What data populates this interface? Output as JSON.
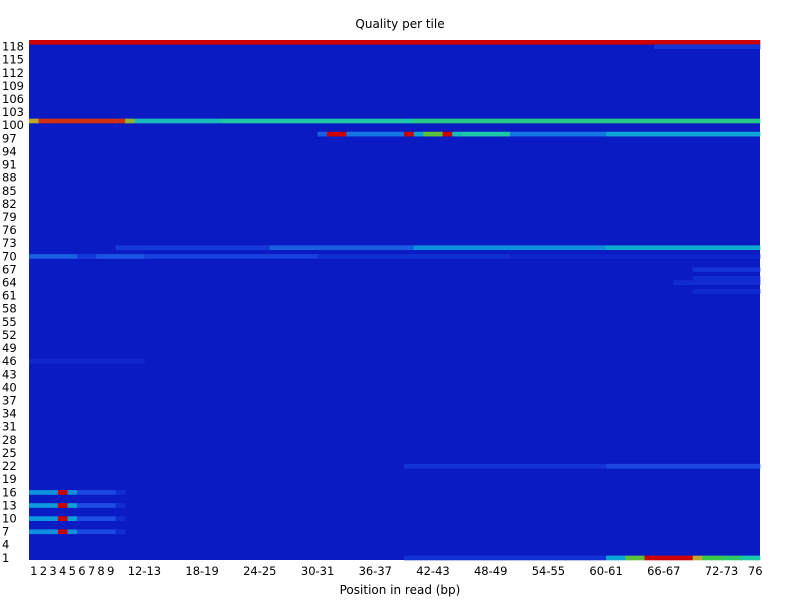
{
  "chart_data": {
    "type": "heatmap",
    "title": "Quality per tile",
    "xlabel": "Position in read (bp)",
    "ylabel": "",
    "x_tick_labels": [
      "1",
      "2",
      "3",
      "4",
      "5",
      "6",
      "7",
      "8",
      "9",
      "12-13",
      "18-19",
      "24-25",
      "30-31",
      "36-37",
      "42-43",
      "48-49",
      "54-55",
      "60-61",
      "66-67",
      "72-73",
      "76"
    ],
    "y_tick_labels": [
      "1",
      "4",
      "7",
      "10",
      "13",
      "16",
      "19",
      "22",
      "25",
      "28",
      "31",
      "34",
      "37",
      "40",
      "43",
      "46",
      "49",
      "52",
      "55",
      "58",
      "61",
      "64",
      "67",
      "70",
      "73",
      "76",
      "79",
      "82",
      "85",
      "88",
      "91",
      "94",
      "97",
      "100",
      "103",
      "106",
      "109",
      "112",
      "115",
      "118"
    ],
    "x_range": [
      1,
      76
    ],
    "y_range": [
      1,
      118
    ],
    "color_scale": [
      "#0a1bc4",
      "#1e4ee6",
      "#0aa0dc",
      "#1cc8a8",
      "#3cc83c",
      "#e0a030",
      "#cc0000"
    ],
    "background_value": 0,
    "rows": [
      {
        "tile": 119,
        "segments": [
          {
            "from": 1,
            "to": 76,
            "value": 1.0
          }
        ]
      },
      {
        "tile": 118,
        "segments": [
          {
            "from": 66,
            "to": 76,
            "value": 0.08
          }
        ]
      },
      {
        "tile": 101,
        "segments": [
          {
            "from": 1,
            "to": 1,
            "value": 0.8
          },
          {
            "from": 2,
            "to": 10,
            "value": 0.95
          },
          {
            "from": 11,
            "to": 11,
            "value": 0.75
          },
          {
            "from": 12,
            "to": 20,
            "value": 0.45
          },
          {
            "from": 21,
            "to": 40,
            "value": 0.5
          },
          {
            "from": 41,
            "to": 60,
            "value": 0.55
          },
          {
            "from": 61,
            "to": 76,
            "value": 0.55
          }
        ]
      },
      {
        "tile": 98,
        "segments": [
          {
            "from": 31,
            "to": 31,
            "value": 0.2
          },
          {
            "from": 32,
            "to": 33,
            "value": 1.0
          },
          {
            "from": 34,
            "to": 39,
            "value": 0.25
          },
          {
            "from": 40,
            "to": 40,
            "value": 1.0
          },
          {
            "from": 41,
            "to": 41,
            "value": 0.35
          },
          {
            "from": 42,
            "to": 43,
            "value": 0.7
          },
          {
            "from": 44,
            "to": 44,
            "value": 1.0
          },
          {
            "from": 45,
            "to": 45,
            "value": 0.45
          },
          {
            "from": 46,
            "to": 50,
            "value": 0.5
          },
          {
            "from": 51,
            "to": 60,
            "value": 0.25
          },
          {
            "from": 61,
            "to": 76,
            "value": 0.35
          }
        ]
      },
      {
        "tile": 72,
        "segments": [
          {
            "from": 10,
            "to": 25,
            "value": 0.1
          },
          {
            "from": 26,
            "to": 40,
            "value": 0.2
          },
          {
            "from": 41,
            "to": 60,
            "value": 0.3
          },
          {
            "from": 61,
            "to": 76,
            "value": 0.38
          }
        ]
      },
      {
        "tile": 70,
        "segments": [
          {
            "from": 1,
            "to": 5,
            "value": 0.2
          },
          {
            "from": 6,
            "to": 7,
            "value": 0.1
          },
          {
            "from": 8,
            "to": 12,
            "value": 0.18
          },
          {
            "from": 13,
            "to": 30,
            "value": 0.12
          },
          {
            "from": 31,
            "to": 50,
            "value": 0.07
          },
          {
            "from": 51,
            "to": 76,
            "value": 0.03
          }
        ]
      },
      {
        "tile": 67,
        "segments": [
          {
            "from": 70,
            "to": 76,
            "value": 0.08
          }
        ]
      },
      {
        "tile": 65,
        "segments": [
          {
            "from": 70,
            "to": 76,
            "value": 0.06
          }
        ]
      },
      {
        "tile": 64,
        "segments": [
          {
            "from": 68,
            "to": 76,
            "value": 0.06
          }
        ]
      },
      {
        "tile": 62,
        "segments": [
          {
            "from": 70,
            "to": 76,
            "value": 0.05
          }
        ]
      },
      {
        "tile": 46,
        "segments": [
          {
            "from": 1,
            "to": 12,
            "value": 0.04
          }
        ]
      },
      {
        "tile": 22,
        "segments": [
          {
            "from": 40,
            "to": 60,
            "value": 0.08
          },
          {
            "from": 61,
            "to": 76,
            "value": 0.14
          }
        ]
      },
      {
        "tile": 16,
        "segments": [
          {
            "from": 1,
            "to": 3,
            "value": 0.3
          },
          {
            "from": 4,
            "to": 4,
            "value": 1.0
          },
          {
            "from": 5,
            "to": 5,
            "value": 0.3
          },
          {
            "from": 6,
            "to": 9,
            "value": 0.15
          },
          {
            "from": 10,
            "to": 10,
            "value": 0.06
          }
        ]
      },
      {
        "tile": 13,
        "segments": [
          {
            "from": 1,
            "to": 3,
            "value": 0.32
          },
          {
            "from": 4,
            "to": 4,
            "value": 1.0
          },
          {
            "from": 5,
            "to": 5,
            "value": 0.34
          },
          {
            "from": 6,
            "to": 9,
            "value": 0.16
          },
          {
            "from": 10,
            "to": 10,
            "value": 0.06
          }
        ]
      },
      {
        "tile": 10,
        "segments": [
          {
            "from": 1,
            "to": 3,
            "value": 0.32
          },
          {
            "from": 4,
            "to": 4,
            "value": 1.0
          },
          {
            "from": 5,
            "to": 5,
            "value": 0.34
          },
          {
            "from": 6,
            "to": 9,
            "value": 0.16
          },
          {
            "from": 10,
            "to": 10,
            "value": 0.06
          }
        ]
      },
      {
        "tile": 7,
        "segments": [
          {
            "from": 1,
            "to": 3,
            "value": 0.3
          },
          {
            "from": 4,
            "to": 4,
            "value": 1.0
          },
          {
            "from": 5,
            "to": 5,
            "value": 0.3
          },
          {
            "from": 6,
            "to": 9,
            "value": 0.15
          },
          {
            "from": 10,
            "to": 10,
            "value": 0.06
          }
        ]
      },
      {
        "tile": 1,
        "segments": [
          {
            "from": 40,
            "to": 60,
            "value": 0.08
          },
          {
            "from": 61,
            "to": 62,
            "value": 0.35
          },
          {
            "from": 63,
            "to": 64,
            "value": 0.7
          },
          {
            "from": 65,
            "to": 69,
            "value": 1.0
          },
          {
            "from": 70,
            "to": 70,
            "value": 0.8
          },
          {
            "from": 71,
            "to": 72,
            "value": 0.65
          },
          {
            "from": 73,
            "to": 74,
            "value": 0.6
          },
          {
            "from": 75,
            "to": 76,
            "value": 0.5
          }
        ]
      }
    ]
  }
}
